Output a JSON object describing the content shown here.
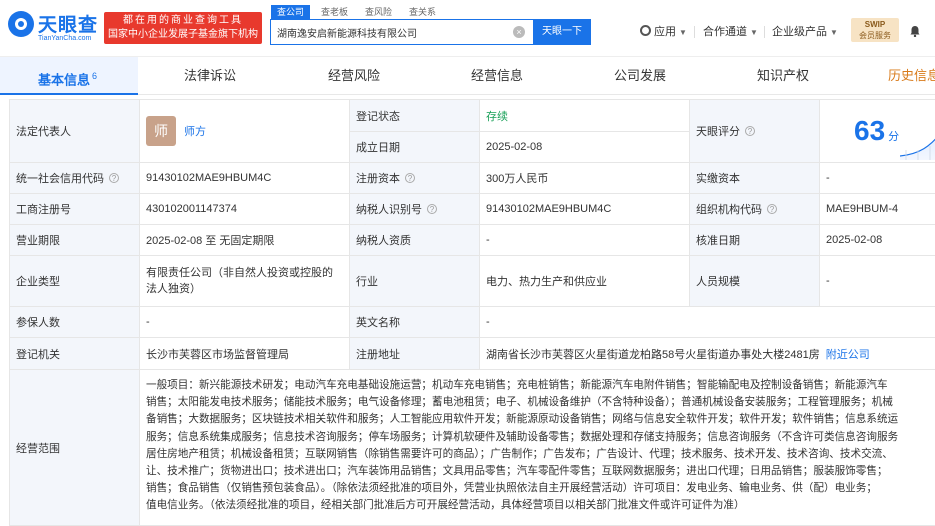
{
  "header": {
    "logo_text": "天眼查",
    "logo_sub": "TianYanCha.com",
    "slogan_line1": "都在用的商业查询工具",
    "slogan_line2": "国家中小企业发展子基金旗下机构",
    "search_tabs": [
      "查公司",
      "查老板",
      "查风险",
      "查关系"
    ],
    "search_value": "湖南逸安启新能源科技有限公司",
    "search_button": "天眼一下",
    "nav_app": "应用",
    "nav_partner": "合作通道",
    "nav_enterprise": "企业级产品",
    "svip_line1": "SWIP",
    "svip_line2": "会员服务",
    "brand_color": "#1a73e8"
  },
  "tabs": {
    "basic": "基本信息",
    "basic_count": "6",
    "legal": "法律诉讼",
    "risk": "经营风险",
    "operation": "经营信息",
    "development": "公司发展",
    "ip": "知识产权",
    "history": "历史信息"
  },
  "info": {
    "legal_rep_label": "法定代表人",
    "legal_rep_avatar": "师",
    "legal_rep_name": "师方",
    "reg_status_label": "登记状态",
    "reg_status": "存续",
    "found_date_label": "成立日期",
    "found_date": "2025-02-08",
    "score_label": "天眼评分",
    "score": "63",
    "score_unit": "分",
    "credit_code_label": "统一社会信用代码",
    "credit_code": "91430102MAE9HBUM4C",
    "reg_capital_label": "注册资本",
    "reg_capital": "300万人民币",
    "paid_capital_label": "实缴资本",
    "paid_capital": "-",
    "reg_no_label": "工商注册号",
    "reg_no": "430102001147374",
    "taxpayer_id_label": "纳税人识别号",
    "taxpayer_id": "91430102MAE9HBUM4C",
    "org_code_label": "组织机构代码",
    "org_code": "MAE9HBUM-4",
    "term_label": "营业期限",
    "term": "2025-02-08 至 无固定期限",
    "taxpayer_qual_label": "纳税人资质",
    "taxpayer_qual": "-",
    "approve_date_label": "核准日期",
    "approve_date": "2025-02-08",
    "company_type_label": "企业类型",
    "company_type": "有限责任公司（非自然人投资或控股的法人独资）",
    "industry_label": "行业",
    "industry": "电力、热力生产和供应业",
    "staff_size_label": "人员规模",
    "staff_size": "-",
    "insured_label": "参保人数",
    "insured": "-",
    "english_name_label": "英文名称",
    "english_name": "-",
    "reg_authority_label": "登记机关",
    "reg_authority": "长沙市芙蓉区市场监督管理局",
    "reg_address_label": "注册地址",
    "reg_address": "湖南省长沙市芙蓉区火星街道龙柏路58号火星街道办事处大楼2481房",
    "nearby_company": "附近公司",
    "scope_label": "经营范围",
    "scope_lines": [
      "一般项目：新兴能源技术研发；电动汽车充电基础设施运营；机动车充电销售；充电桩销售；新能源汽车电附件销售；智能输配电及控制设备销售；新能源汽车",
      "销售；太阳能发电技术服务；储能技术服务；电气设备修理；蓄电池租赁；电子、机械设备维护（不含特种设备）；普通机械设备安装服务；工程管理服务；机械",
      "备销售；大数据服务；区块链技术相关软件和服务；人工智能应用软件开发；新能源原动设备销售；网络与信息安全软件开发；软件开发；软件销售；信息系统运",
      "服务；信息系统集成服务；信息技术咨询服务；停车场服务；计算机软硬件及辅助设备零售；数据处理和存储支持服务；信息咨询服务（不含许可类信息咨询服务",
      "居住房地产租赁；机械设备租赁；互联网销售（除销售需要许可的商品）；广告制作；广告发布；广告设计、代理；技术服务、技术开发、技术咨询、技术交流、",
      "让、技术推广；货物进出口；技术进出口；汽车装饰用品销售；文具用品零售；汽车零配件零售；互联网数据服务；进出口代理；日用品销售；服装服饰零售；",
      "销售；食品销售（仅销售预包装食品）。（除依法须经批准的项目外，凭营业执照依法自主开展经营活动）许可项目：发电业务、输电业务、供（配）电业务；",
      "值电信业务。（依法须经批准的项目，经相关部门批准后方可开展经营活动，具体经营项目以相关部门批准文件或许可证件为准）"
    ]
  }
}
